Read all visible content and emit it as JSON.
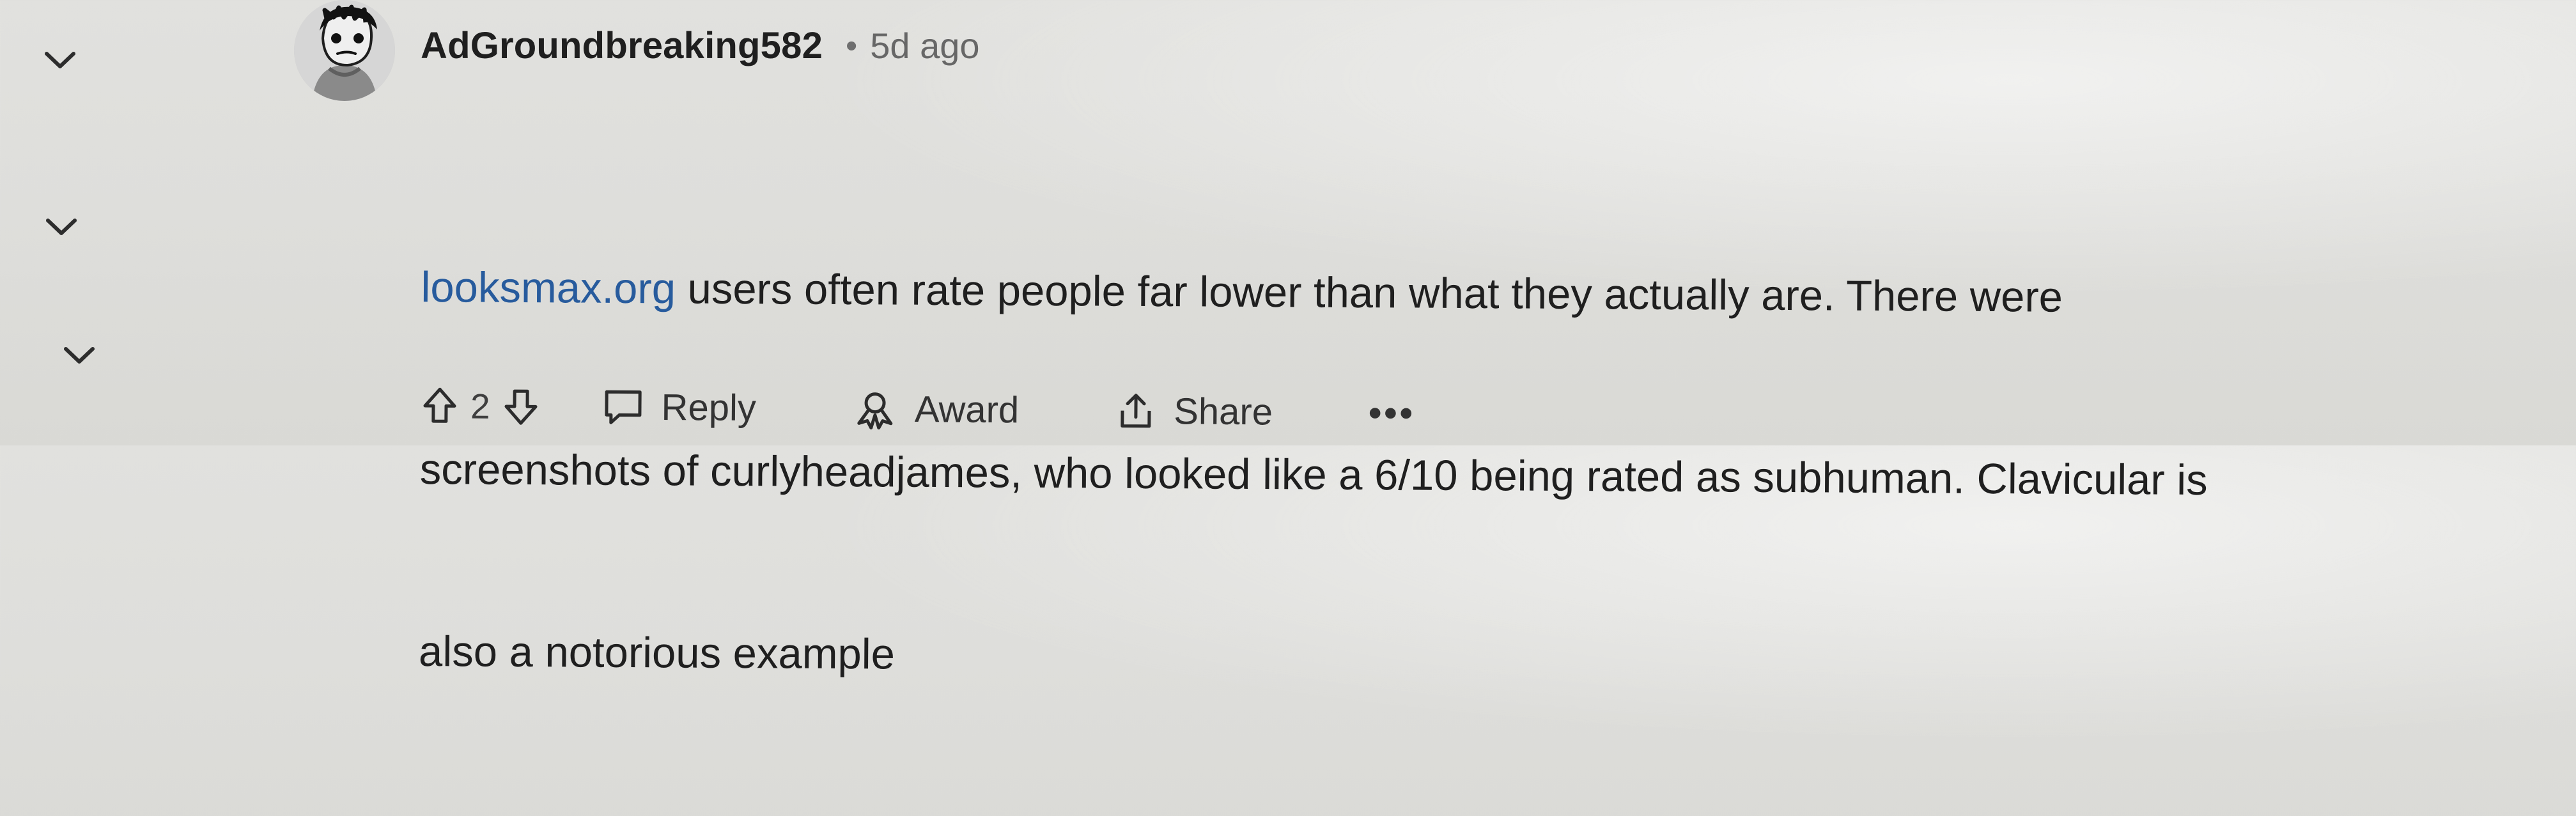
{
  "threadline": {
    "collapse_icons": [
      "chevron-down-icon",
      "chevron-down-icon",
      "chevron-down-icon"
    ]
  },
  "comment": {
    "author": "AdGroundbreaking582",
    "separator": "•",
    "timestamp": "5d ago",
    "body": {
      "link_text": "looksmax.org",
      "line1_rest": " users often rate people far lower than what they actually are. There were",
      "line2": "screenshots of curlyheadjames, who looked like a 6/10 being rated as subhuman. Clavicular is",
      "line3": "also a notorious example"
    },
    "actions": {
      "upvote_icon": "upvote-arrow-icon",
      "vote_count": "2",
      "downvote_icon": "downvote-arrow-icon",
      "reply_icon": "comment-icon",
      "reply_label": "Reply",
      "award_icon": "award-icon",
      "award_label": "Award",
      "share_icon": "share-icon",
      "share_label": "Share",
      "more_label": "•••"
    }
  },
  "colors": {
    "background": "#dededb",
    "link": "#275b9d",
    "text": "#1f1f1f",
    "meta": "#676767"
  }
}
